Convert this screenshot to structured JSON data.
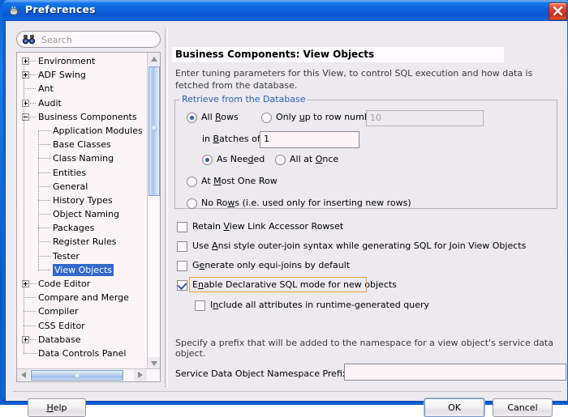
{
  "window": {
    "title": "Preferences",
    "icon": "coffee-cup-icon",
    "close_label": "×"
  },
  "search": {
    "placeholder": "Search",
    "value": "",
    "icon": "binoculars-icon"
  },
  "tree": {
    "items": [
      {
        "label": "Environment",
        "depth": 0,
        "toggle": "plus",
        "selected": false
      },
      {
        "label": "ADF Swing",
        "depth": 0,
        "toggle": "plus",
        "selected": false
      },
      {
        "label": "Ant",
        "depth": 0,
        "toggle": "none",
        "selected": false
      },
      {
        "label": "Audit",
        "depth": 0,
        "toggle": "plus",
        "selected": false
      },
      {
        "label": "Business Components",
        "depth": 0,
        "toggle": "minus",
        "selected": false
      },
      {
        "label": "Application Modules",
        "depth": 1,
        "toggle": "none",
        "selected": false
      },
      {
        "label": "Base Classes",
        "depth": 1,
        "toggle": "none",
        "selected": false
      },
      {
        "label": "Class Naming",
        "depth": 1,
        "toggle": "none",
        "selected": false
      },
      {
        "label": "Entities",
        "depth": 1,
        "toggle": "none",
        "selected": false
      },
      {
        "label": "General",
        "depth": 1,
        "toggle": "none",
        "selected": false
      },
      {
        "label": "History Types",
        "depth": 1,
        "toggle": "none",
        "selected": false
      },
      {
        "label": "Object Naming",
        "depth": 1,
        "toggle": "none",
        "selected": false
      },
      {
        "label": "Packages",
        "depth": 1,
        "toggle": "none",
        "selected": false
      },
      {
        "label": "Register Rules",
        "depth": 1,
        "toggle": "none",
        "selected": false
      },
      {
        "label": "Tester",
        "depth": 1,
        "toggle": "none",
        "selected": false
      },
      {
        "label": "View Objects",
        "depth": 1,
        "toggle": "none",
        "selected": true
      },
      {
        "label": "Code Editor",
        "depth": 0,
        "toggle": "plus",
        "selected": false
      },
      {
        "label": "Compare and Merge",
        "depth": 0,
        "toggle": "none",
        "selected": false
      },
      {
        "label": "Compiler",
        "depth": 0,
        "toggle": "none",
        "selected": false
      },
      {
        "label": "CSS Editor",
        "depth": 0,
        "toggle": "none",
        "selected": false
      },
      {
        "label": "Database",
        "depth": 0,
        "toggle": "plus",
        "selected": false
      },
      {
        "label": "Data Controls Panel",
        "depth": 0,
        "toggle": "none",
        "selected": false
      }
    ]
  },
  "page": {
    "title": "Business Components: View Objects",
    "description": "Enter tuning parameters for this View, to control SQL execution and how data is fetched from the database."
  },
  "group": {
    "title": "Retrieve from the Database",
    "all_rows": {
      "label_pre": "All ",
      "mnemonic": "R",
      "label_post": "ows",
      "selected": true
    },
    "only_up_to": {
      "label_pre": "Only ",
      "mnemonic": "u",
      "label_post": "p to row number",
      "selected": false
    },
    "row_number_value": "10",
    "row_number_disabled": true,
    "batches_label_pre": "in ",
    "batches_mnemonic": "B",
    "batches_label_post": "atches of:",
    "batches_value": "1",
    "as_needed": {
      "label_pre": "As Nee",
      "mnemonic": "d",
      "label_post": "ed",
      "selected": true
    },
    "all_at_once": {
      "label_pre": "All at ",
      "mnemonic": "O",
      "label_post": "nce",
      "selected": false
    },
    "at_most_one_row": {
      "label_pre": "At ",
      "mnemonic": "M",
      "label_post": "ost One Row",
      "selected": false
    },
    "no_rows": {
      "label_pre": "No Ro",
      "mnemonic": "w",
      "label_post": "s (i.e. used only for inserting new rows)",
      "selected": false
    }
  },
  "checkboxes": [
    {
      "label_pre": "Retain ",
      "mnemonic": "V",
      "label_post": "iew Link Accessor Rowset",
      "checked": false,
      "focused": false
    },
    {
      "label_pre": "Use ",
      "mnemonic": "A",
      "label_post": "nsi style outer-join syntax while generating SQL for Join View Objects",
      "checked": false,
      "focused": false
    },
    {
      "label_pre": "G",
      "mnemonic": "e",
      "label_post": "nerate only equi-joins by default",
      "checked": false,
      "focused": false
    },
    {
      "label_pre": "E",
      "mnemonic": "n",
      "label_post": "able Declarative SQL mode for new objects",
      "checked": true,
      "focused": true
    },
    {
      "label_pre": "I",
      "mnemonic": "n",
      "label_post": "clude all attributes in runtime-generated query",
      "checked": false,
      "focused": false
    }
  ],
  "bottom": {
    "note": "Specify a prefix that will be added to the namespace for a view object's service data object.",
    "sdo_label": "Service Data Object Namespace Prefix:",
    "sdo_value": ""
  },
  "buttons": {
    "help_pre": "",
    "help_mnemonic": "H",
    "help_post": "elp",
    "ok": "OK",
    "cancel": "Cancel"
  },
  "colors": {
    "titlebar_blue": "#0c62dd",
    "selection_blue": "#3267cc",
    "group_title_blue": "#2a5fb8",
    "focus_orange": "#e8a33d",
    "dialog_bg": "#ece9ef",
    "field_bg": "#fdf4f7",
    "close_red": "#c32d17"
  }
}
